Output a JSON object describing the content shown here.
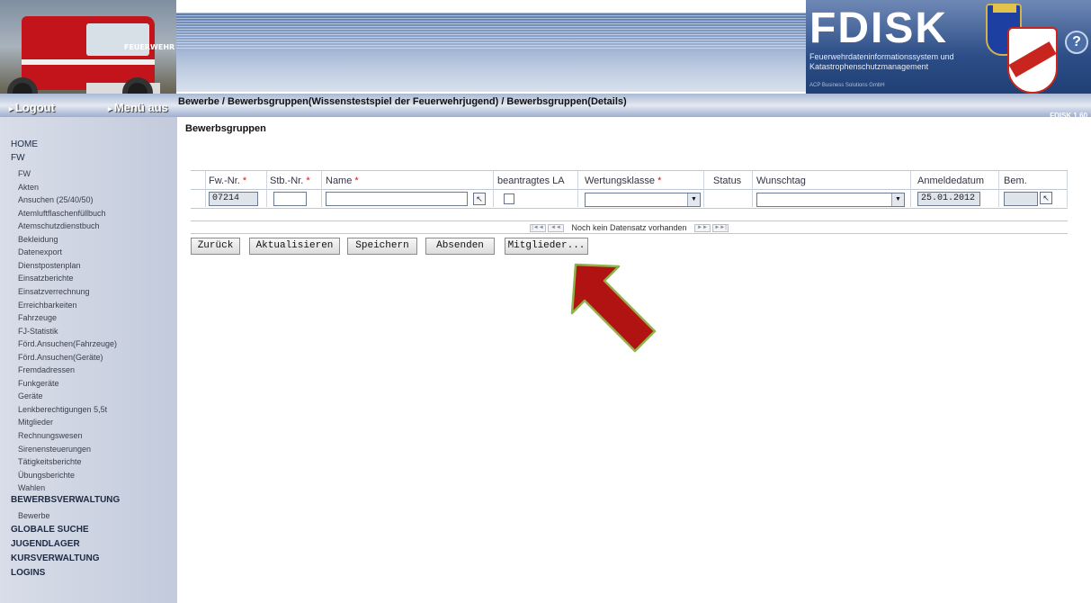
{
  "header": {
    "brand_title": "FDISK",
    "brand_subtitle": "Feuerwehrdateninformationssystem und Katastrophenschutzmanagement",
    "brand_company": "ACP Business Solutions GmbH",
    "truck_label": "FEUERWEHR",
    "help_label": "?",
    "version": "FDISK 1.60"
  },
  "topbar": {
    "logout_label": "Logout",
    "menu_label": "Menü aus",
    "breadcrumb": "Bewerbe / Bewerbsgruppen(Wissenstestspiel der Feuerwehrjugend) / Bewerbsgruppen(Details)"
  },
  "sidebar": {
    "home": "HOME",
    "fw": "FW",
    "fw_items": [
      "FW",
      "Akten",
      "Ansuchen (25/40/50)",
      "Atemluftflaschenfüllbuch",
      "Atemschutzdienstbuch",
      "Bekleidung",
      "Datenexport",
      "Dienstpostenplan",
      "Einsatzberichte",
      "Einsatzverrechnung",
      "Erreichbarkeiten",
      "Fahrzeuge",
      "FJ-Statistik",
      "Förd.Ansuchen(Fahrzeuge)",
      "Förd.Ansuchen(Geräte)",
      "Fremdadressen",
      "Funkgeräte",
      "Geräte",
      "Lenkberechtigungen 5,5t",
      "Mitglieder",
      "Rechnungswesen",
      "Sirenensteuerungen",
      "Tätigkeitsberichte",
      "Übungsberichte",
      "Wahlen"
    ],
    "bewerbsverwaltung": "BEWERBSVERWALTUNG",
    "bewerbe": "Bewerbe",
    "globale_suche": "GLOBALE SUCHE",
    "jugendlager": "JUGENDLAGER",
    "kursverwaltung": "KURSVERWALTUNG",
    "logins": "LOGINS"
  },
  "main": {
    "title": "Bewerbsgruppen",
    "columns": {
      "fw_nr": "Fw.-Nr.",
      "stb_nr": "Stb.-Nr.",
      "name": "Name",
      "beantragtes_la": "beantragtes LA",
      "wertungsklasse": "Wertungsklasse",
      "status": "Status",
      "wunschtag": "Wunschtag",
      "anmeldedatum": "Anmeldedatum",
      "bem": "Bem."
    },
    "required_marker": "*",
    "row": {
      "fw_nr": "07214",
      "stb_nr": "",
      "name": "",
      "anmeldedatum": "25.01.2012",
      "bem": ""
    },
    "pager_text": "Noch kein Datensatz vorhanden",
    "buttons": {
      "zurueck": "Zurück",
      "aktualisieren": "Aktualisieren",
      "speichern": "Speichern",
      "absenden": "Absenden",
      "mitglieder": "Mitglieder..."
    }
  },
  "colors": {
    "sidebar_bg": "#c3cbdc",
    "brand_blue": "#203f76",
    "annotation_arrow": "#b11212",
    "required": "#dd1111"
  }
}
